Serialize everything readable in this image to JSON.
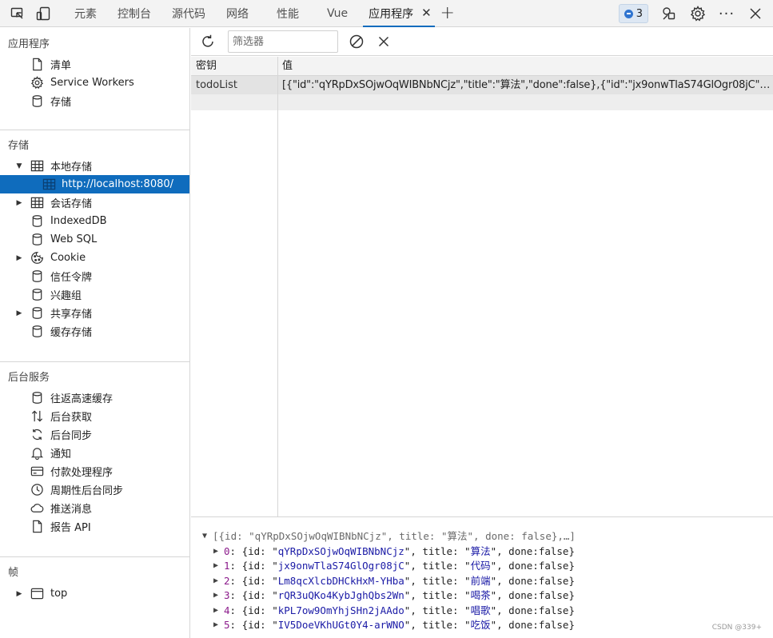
{
  "tabs": [
    {
      "label": "元素"
    },
    {
      "label": "控制台"
    },
    {
      "label": "源代码"
    },
    {
      "label": "网络"
    },
    {
      "label": "性能"
    },
    {
      "label": "Vue"
    },
    {
      "label": "应用程序"
    }
  ],
  "active_tab": "应用程序",
  "issues_badge": {
    "count": "3"
  },
  "sidebar": {
    "app_section": {
      "title": "应用程序",
      "items": [
        "清单",
        "Service Workers",
        "存储"
      ]
    },
    "storage_section": {
      "title": "存储",
      "local_storage": "本地存储",
      "local_origin": "http://localhost:8080/",
      "session_storage": "会话存储",
      "indexeddb": "IndexedDB",
      "websql": "Web SQL",
      "cookie": "Cookie",
      "trust_tokens": "信任令牌",
      "interest_groups": "兴趣组",
      "shared_storage": "共享存储",
      "cache_storage": "缓存存储"
    },
    "background_section": {
      "title": "后台服务",
      "items": [
        "往返高速缓存",
        "后台获取",
        "后台同步",
        "通知",
        "付款处理程序",
        "周期性后台同步",
        "推送消息",
        "报告 API"
      ]
    },
    "frames_section": {
      "title": "帧",
      "top": "top"
    }
  },
  "toolbar": {
    "filter_placeholder": "筛选器"
  },
  "grid": {
    "headers": {
      "key": "密钥",
      "value": "值"
    },
    "rows": [
      {
        "key": "todoList",
        "value": "[{\"id\":\"qYRpDxSOjwOqWIBNbNCjz\",\"title\":\"算法\",\"done\":false},{\"id\":\"jx9onwTlaS74GlOgr08jC\",\"tit..."
      }
    ]
  },
  "preview": {
    "summary": "[{id: \"qYRpDxSOjwOqWIBNbNCjz\", title: \"算法\", done: false},…]",
    "items": [
      {
        "index": "0",
        "id": "qYRpDxSOjwOqWIBNbNCjz",
        "title": "算法",
        "done": "false"
      },
      {
        "index": "1",
        "id": "jx9onwTlaS74GlOgr08jC",
        "title": "代码",
        "done": "false"
      },
      {
        "index": "2",
        "id": "Lm8qcXlcbDHCkHxM-YHba",
        "title": "前端",
        "done": "false"
      },
      {
        "index": "3",
        "id": "rQR3uQKo4KybJghQbs2Wn",
        "title": "喝茶",
        "done": "false"
      },
      {
        "index": "4",
        "id": "kPL7ow9OmYhjSHn2jAAdo",
        "title": "唱歌",
        "done": "false"
      },
      {
        "index": "5",
        "id": "IV5DoeVKhUGt0Y4-arWNO",
        "title": "吃饭",
        "done": "false"
      }
    ]
  },
  "watermark": "CSDN @339+",
  "colors": {
    "accent": "#0f6cbd",
    "selected_row": "#e3e3e3"
  }
}
